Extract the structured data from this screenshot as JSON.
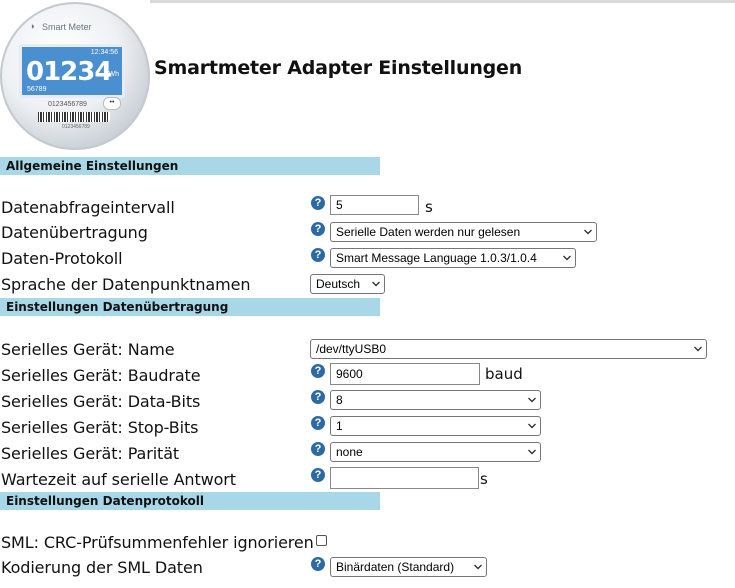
{
  "logo": {
    "brand": "Smart Meter",
    "time": "12:34:56",
    "reading": "01234",
    "unit": "kWh",
    "sub": "56789",
    "serial": "0123456789",
    "barcode_number": "0123456789"
  },
  "page_title": "Smartmeter Adapter Einstellungen",
  "sections": {
    "general": "Allgemeine Einstellungen",
    "transfer": "Einstellungen Datenübertragung",
    "protocol": "Einstellungen Datenprotokoll"
  },
  "fields": {
    "interval": {
      "label": "Datenabfrageintervall",
      "value": "5",
      "unit": "s"
    },
    "transfer": {
      "label": "Datenübertragung",
      "value": "Serielle Daten werden nur gelesen"
    },
    "protocol": {
      "label": "Daten-Protokoll",
      "value": "Smart Message Language 1.0.3/1.0.4"
    },
    "language": {
      "label": "Sprache der Datenpunktnamen",
      "value": "Deutsch"
    },
    "serial_name": {
      "label": "Serielles Gerät: Name",
      "value": "/dev/ttyUSB0"
    },
    "baudrate": {
      "label": "Serielles Gerät: Baudrate",
      "value": "9600",
      "unit": "baud"
    },
    "databits": {
      "label": "Serielles Gerät: Data-Bits",
      "value": "8"
    },
    "stopbits": {
      "label": "Serielles Gerät: Stop-Bits",
      "value": "1"
    },
    "parity": {
      "label": "Serielles Gerät: Parität",
      "value": "none"
    },
    "wait": {
      "label": "Wartezeit auf serielle Antwort",
      "value": "",
      "unit": "s"
    },
    "crc": {
      "label": "SML: CRC-Prüfsummenfehler ignorieren",
      "checked": false
    },
    "encoding": {
      "label": "Kodierung der SML Daten",
      "value": "Binärdaten (Standard)"
    }
  },
  "help_glyph": "?",
  "colors": {
    "section_bg": "#a8d8e8",
    "help_icon": "#2d6aa3"
  }
}
